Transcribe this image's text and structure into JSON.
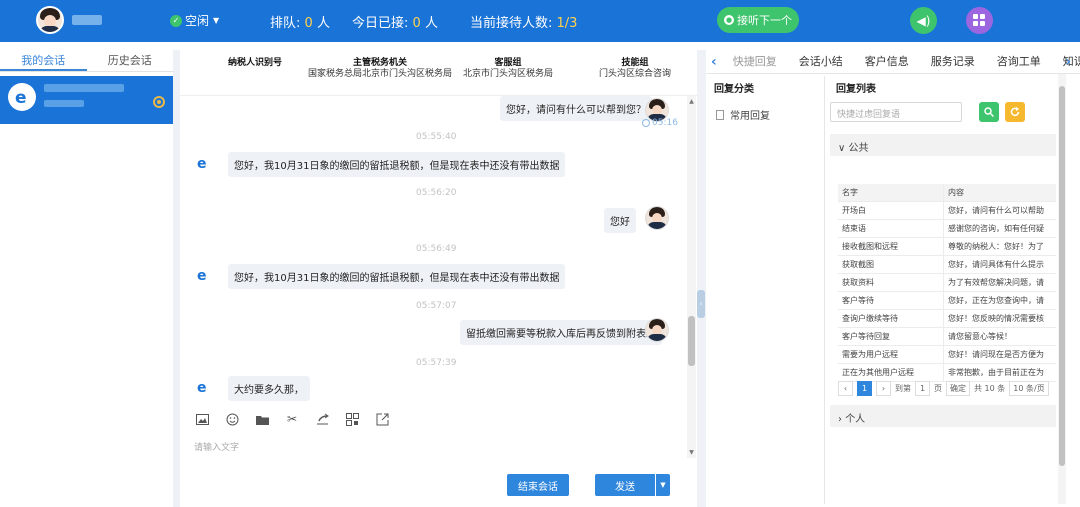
{
  "header": {
    "status_label": "空闲",
    "queue_label": "排队:",
    "queue_count": "0",
    "queue_unit": "人",
    "today_label": "今日已接:",
    "today_count": "0",
    "today_unit": "人",
    "current_label": "当前接待人数:",
    "current_value": "1/3",
    "next_button": "接听下一个"
  },
  "left_tabs": [
    "我的会话",
    "历史会话"
  ],
  "info": [
    {
      "head": "纳税人识别号",
      "value": ""
    },
    {
      "head": "主管税务机关",
      "value": "国家税务总局北京市门头沟区税务局"
    },
    {
      "head": "客服组",
      "value": "北京市门头沟区税务局"
    },
    {
      "head": "技能组",
      "value": "门头沟区综合咨询"
    }
  ],
  "messages": {
    "m1": "您好，请问有什么可以帮到您？",
    "m1_time": "05:16",
    "t1": "05:55:40",
    "m2": "您好，我10月31日象的缴回的留抵退税额，但是现在表中还没有带出数据",
    "t2": "05:56:20",
    "m3": "您好",
    "t3": "05:56:49",
    "m4": "您好，我10月31日象的缴回的留抵退税额，但是现在表中还没有带出数据",
    "t4": "05:57:07",
    "m5": "留抵缴回需要等税款入库后再反馈到附表二",
    "t5": "05:57:39",
    "m6": "大约要多久那，"
  },
  "input_placeholder": "请输入文字",
  "end_button": "结束会话",
  "send_button": "发送",
  "right_tabs": [
    "快捷回复",
    "会话小结",
    "客户信息",
    "服务记录",
    "咨询工单",
    "知识"
  ],
  "categories_title": "回复分类",
  "categories": [
    "常用回复"
  ],
  "list_title": "回复列表",
  "search_placeholder": "快捷过虑回复语",
  "group_public": "公共",
  "group_personal": "个人",
  "table_head": [
    "名字",
    "内容"
  ],
  "table_rows": [
    [
      "开场白",
      "您好，请问有什么可以帮助"
    ],
    [
      "结束语",
      "感谢您的咨询，如有任何疑"
    ],
    [
      "接收截图和远程",
      "尊敬的纳税人：您好！为了"
    ],
    [
      "获取截图",
      "您好，请问具体有什么提示"
    ],
    [
      "获取资料",
      "为了有效帮您解决问题，请"
    ],
    [
      "客户等待",
      "您好，正在为您查询中，请"
    ],
    [
      "查询户缴续等待",
      "您好！您反映的情况需要核"
    ],
    [
      "客户等待回复",
      "请您留意心等候！"
    ],
    [
      "需要为用户远程",
      "您好！请问现在是否方便为"
    ],
    [
      "正在为其他用户远程",
      "非常抱歉，由于目前正在为"
    ]
  ],
  "pager": {
    "page": "1",
    "goto_label": "到第",
    "goto_value": "1",
    "page_unit": "页",
    "confirm": "确定",
    "total": "共 10 条",
    "per_page": "10 条/页"
  }
}
